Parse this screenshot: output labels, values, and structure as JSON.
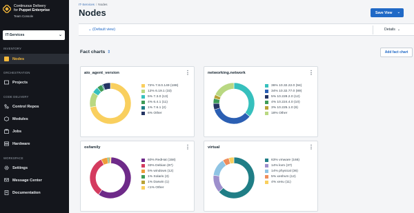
{
  "brand": {
    "line1": "Continuous Delivery",
    "line2": "for",
    "line2b": "Puppet Enterprise",
    "sub": "Team Console"
  },
  "workspace": {
    "selected": "IT-Services"
  },
  "sidebar": {
    "sections": [
      {
        "title": "INVENTORY",
        "items": [
          {
            "label": "Nodes",
            "icon": "nodes-icon",
            "active": true
          }
        ]
      },
      {
        "title": "ORCHESTRATION",
        "items": [
          {
            "label": "Projects",
            "icon": "projects-icon"
          }
        ]
      },
      {
        "title": "CODE DELIVERY",
        "items": [
          {
            "label": "Control Repos",
            "icon": "repo-icon"
          },
          {
            "label": "Modules",
            "icon": "modules-icon"
          },
          {
            "label": "Jobs",
            "icon": "jobs-icon"
          },
          {
            "label": "Hardware",
            "icon": "hardware-icon"
          }
        ]
      },
      {
        "title": "WORKSPACE",
        "items": [
          {
            "label": "Settings",
            "icon": "gear-icon"
          },
          {
            "label": "Message Center",
            "icon": "message-icon"
          },
          {
            "label": "Documentation",
            "icon": "doc-icon"
          }
        ]
      }
    ]
  },
  "breadcrumb": {
    "parent": "IT-Services",
    "sep": "/",
    "current": "Nodes"
  },
  "page": {
    "title": "Nodes",
    "save_view": "Save View"
  },
  "viewbar": {
    "view_label": "(Default view)",
    "details": "Details"
  },
  "facts": {
    "title": "Fact charts",
    "add_button": "Add fact chart"
  },
  "colors": {
    "yellow": "#f9cf5e",
    "lightgreen": "#b9d882",
    "teal": "#36c0bd",
    "green": "#3e9c58",
    "darkteal": "#207e86",
    "navy": "#243463",
    "blue": "#2b5fb3",
    "purple": "#6e2a89",
    "crimson": "#d43b5f",
    "orange": "#ee9d3a",
    "violet": "#8b6fc0",
    "lavender": "#9d8fcc",
    "lightblue": "#8fc4e4",
    "olive": "#b8a236",
    "salmon": "#ef8d5b"
  },
  "chart_data": [
    {
      "type": "pie",
      "title": "aio_agent_version",
      "labels": [
        "72% 7.8.0.149 (188)",
        "12% 6.19.1 (33)",
        "5% 7.3.0 (13)",
        "4% 6.4.1 (11)",
        "1% 7.6.1 (2)",
        "6% Other"
      ],
      "values": [
        72,
        12,
        5,
        4,
        1,
        6
      ],
      "colors": [
        "#f9cf5e",
        "#b9d882",
        "#36c0bd",
        "#3e9c58",
        "#207e86",
        "#243463"
      ]
    },
    {
      "type": "pie",
      "title": "networking.network",
      "labels": [
        "36% 10.32.22.0 (94)",
        "34% 10.32.77.0 (89)",
        "5% 10.228.2.0 (12)",
        "4% 10.224.4.0 (10)",
        "3% 10.225.1.0 (9)",
        "18% Other"
      ],
      "values": [
        36,
        34,
        5,
        4,
        3,
        18
      ],
      "colors": [
        "#36c0bd",
        "#2b5fb3",
        "#243463",
        "#3e9c58",
        "#b8a236",
        "#b9d882"
      ]
    },
    {
      "type": "pie",
      "title": "osfamily",
      "labels": [
        "60% RedHat (158)",
        "33% Debian (87)",
        "5% windows (12)",
        "1% Solaris (3)",
        "1% Darwin (1)",
        "<1% Other"
      ],
      "values": [
        60,
        33,
        5,
        1,
        1,
        0.4
      ],
      "colors": [
        "#6e2a89",
        "#d43b5f",
        "#ee9d3a",
        "#3e9c58",
        "#b8a236",
        "#f9cf5e"
      ]
    },
    {
      "type": "pie",
      "title": "virtual",
      "labels": [
        "63% vmware (166)",
        "14% kvm (37)",
        "14% physical (36)",
        "5% xenhvm (12)",
        "4% xenu (11)"
      ],
      "values": [
        63,
        14,
        14,
        5,
        4
      ],
      "colors": [
        "#207e86",
        "#9d8fcc",
        "#8fc4e4",
        "#ef8d5b",
        "#f9cf5e"
      ]
    }
  ]
}
